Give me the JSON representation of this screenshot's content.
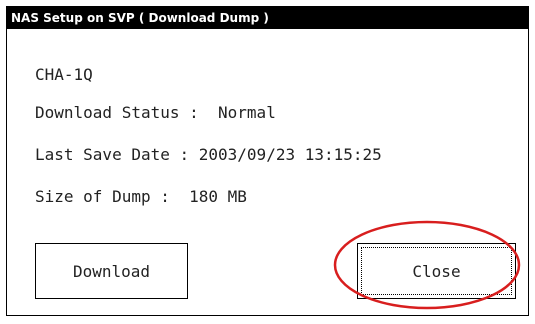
{
  "window": {
    "title": "NAS Setup on SVP ( Download Dump )"
  },
  "info": {
    "cha": "CHA-1Q",
    "download_status": "Download Status :  Normal",
    "last_save_date": "Last Save Date : 2003/09/23 13:15:25",
    "size_of_dump": "Size of Dump :  180 MB"
  },
  "buttons": {
    "download_label": "Download",
    "close_label": "Close"
  },
  "colors": {
    "title_bar": "#000000",
    "title_text": "#ffffff",
    "highlight_ellipse": "#d81e1e"
  }
}
